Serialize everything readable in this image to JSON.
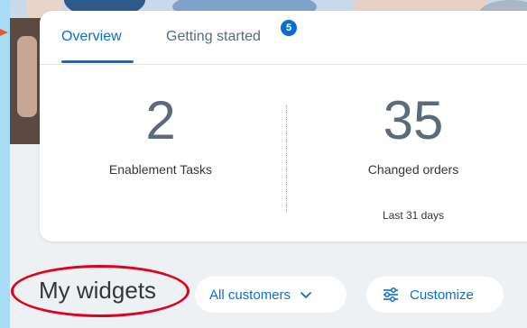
{
  "tabs": {
    "overview": "Overview",
    "getting_started": "Getting started",
    "getting_started_badge": "5"
  },
  "kpis": [
    {
      "value": "2",
      "label": "Enablement Tasks"
    },
    {
      "value": "35",
      "label": "Changed orders",
      "sub": "Last 31 days"
    }
  ],
  "widgets": {
    "title": "My widgets",
    "filter_label": "All customers",
    "customize_label": "Customize"
  },
  "colors": {
    "accent": "#0a6ed1",
    "annotation_red": "#e0001b",
    "annotation_arrow": "#e05a2b",
    "left_strip": "#a7dcf4"
  },
  "icons": {
    "filter_chevron": "chevron-down-icon",
    "customize": "tune-icon"
  }
}
